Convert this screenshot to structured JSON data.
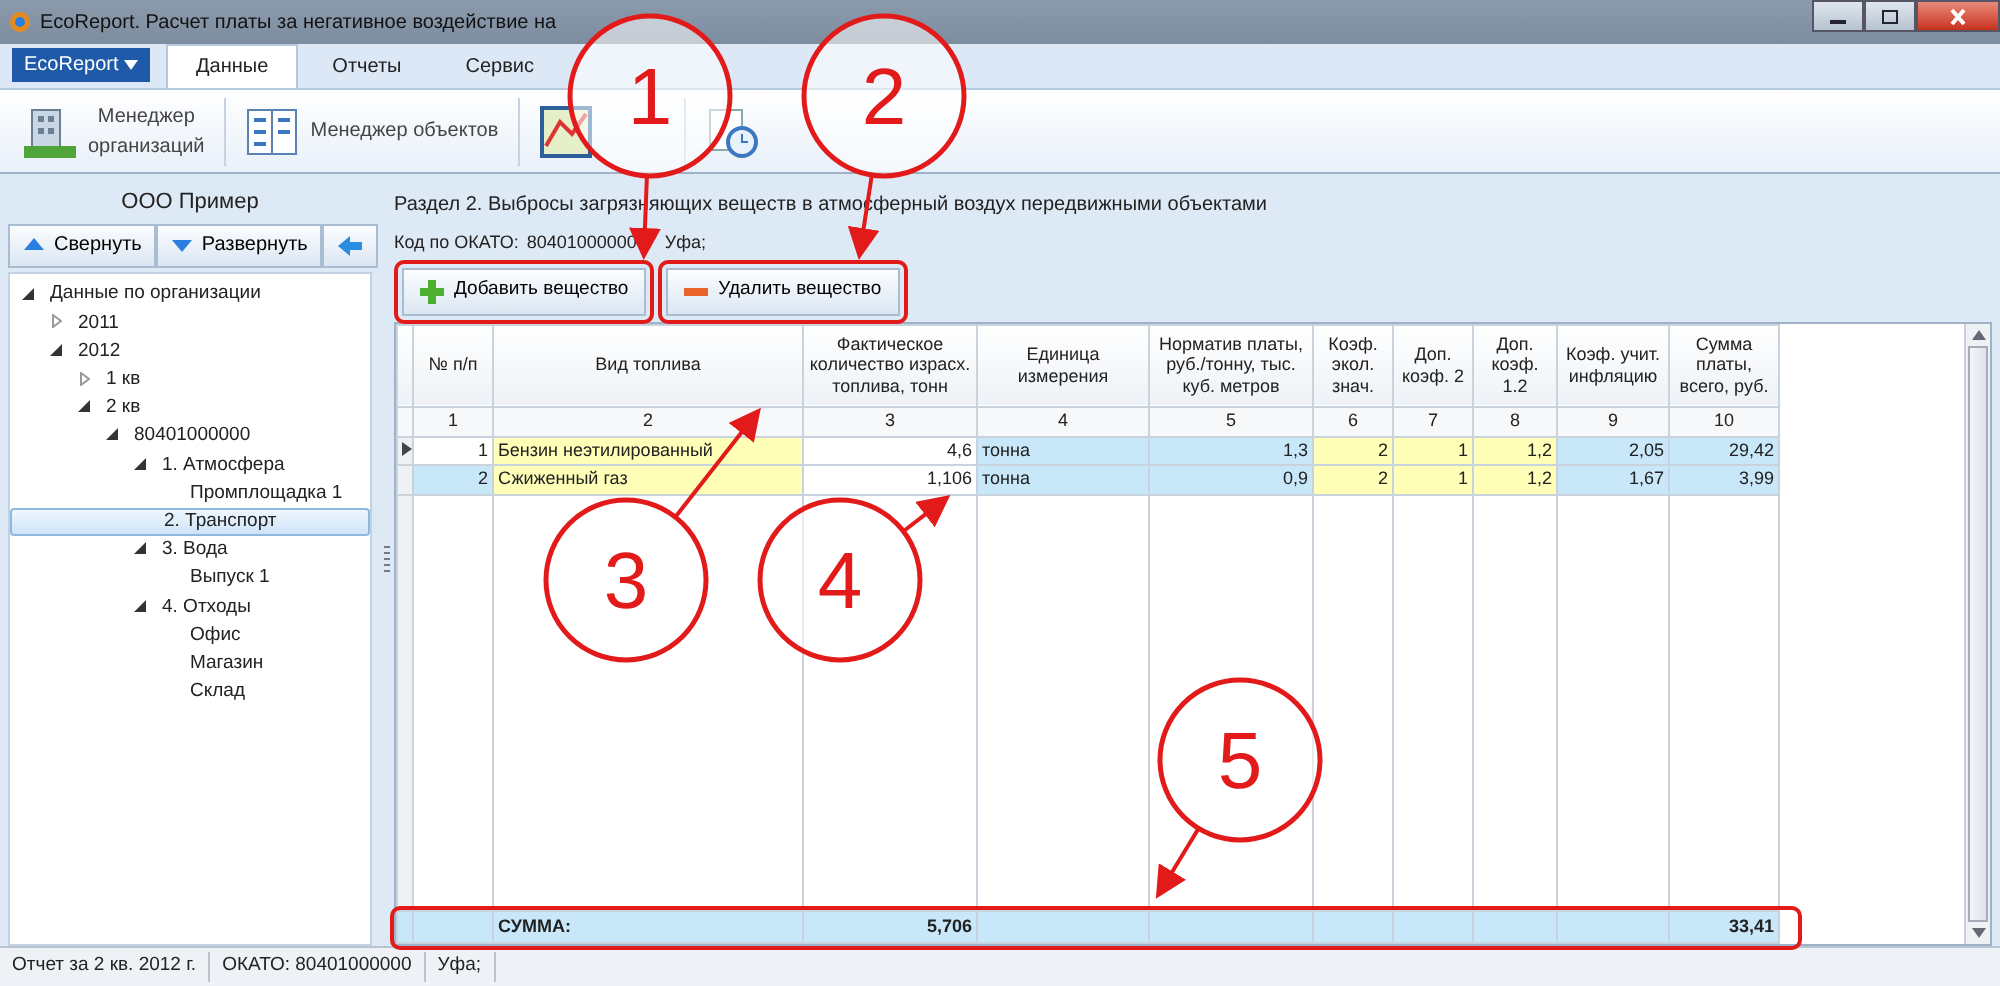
{
  "window": {
    "title": "EcoReport. Расчет платы за негативное воздействие на"
  },
  "app_menu": {
    "label": "EcoReport"
  },
  "tabs": [
    {
      "label": "Данные",
      "selected": true
    },
    {
      "label": "Отчеты",
      "selected": false
    },
    {
      "label": "Сервис",
      "selected": false
    }
  ],
  "ribbon": [
    {
      "kind": "org",
      "label": "Менеджер\nорганизаций"
    },
    {
      "kind": "objects",
      "label": "Менеджер объектов"
    },
    {
      "kind": "map"
    },
    {
      "kind": "calc"
    }
  ],
  "sidebar": {
    "title": "ООО Пример",
    "buttons": [
      {
        "kind": "up",
        "label": "Свернуть"
      },
      {
        "kind": "down",
        "label": "Развернуть"
      },
      {
        "kind": "back"
      }
    ],
    "tree": [
      {
        "label": "Данные по организации",
        "expanded": true,
        "selected": false,
        "children": [
          {
            "label": "2011",
            "expanded": false,
            "selected": false
          },
          {
            "label": "2012",
            "expanded": true,
            "selected": false,
            "children": [
              {
                "label": "1 кв",
                "expanded": false,
                "selected": false
              },
              {
                "label": "2 кв",
                "expanded": true,
                "selected": false,
                "children": [
                  {
                    "label": "80401000000",
                    "expanded": true,
                    "selected": false,
                    "children": [
                      {
                        "label": "1. Атмосфера",
                        "expanded": true,
                        "selected": false,
                        "children": [
                          {
                            "label": "Промплощадка 1",
                            "selected": false
                          }
                        ]
                      },
                      {
                        "label": "2. Транспорт",
                        "selected": true
                      },
                      {
                        "label": "3. Вода",
                        "expanded": true,
                        "selected": false,
                        "children": [
                          {
                            "label": "Выпуск 1",
                            "selected": false
                          }
                        ]
                      },
                      {
                        "label": "4. Отходы",
                        "expanded": true,
                        "selected": false,
                        "children": [
                          {
                            "label": "Офис",
                            "selected": false
                          },
                          {
                            "label": "Магазин",
                            "selected": false
                          },
                          {
                            "label": "Склад",
                            "selected": false
                          }
                        ]
                      }
                    ]
                  }
                ]
              }
            ]
          }
        ]
      }
    ]
  },
  "section": {
    "title": "Раздел 2. Выбросы загрязняющих веществ в атмосферный воздух передвижными объектами",
    "okato_label": "Код по ОКАТО:",
    "okato_value": "80401000000",
    "place": "Уфа;"
  },
  "toolbar": [
    {
      "kind": "add",
      "label": "Добавить вещество"
    },
    {
      "kind": "remove",
      "label": "Удалить вещество"
    }
  ],
  "table": {
    "columns": [
      {
        "header": "№ п/п",
        "number": "1",
        "kind": "plain"
      },
      {
        "header": "Вид топлива",
        "number": "2",
        "kind": "input"
      },
      {
        "header": "Фактическое количество израсх. топлива, тонн",
        "number": "3",
        "kind": "plain"
      },
      {
        "header": "Единица измерения",
        "number": "4",
        "kind": "calc"
      },
      {
        "header": "Норматив платы, руб./тонну, тыс. куб. метров",
        "number": "5",
        "kind": "calc"
      },
      {
        "header": "Коэф. экол. знач.",
        "number": "6",
        "kind": "input"
      },
      {
        "header": "Доп. коэф. 2",
        "number": "7",
        "kind": "input"
      },
      {
        "header": "Доп. коэф. 1.2",
        "number": "8",
        "kind": "input"
      },
      {
        "header": "Коэф. учит. инфляцию",
        "number": "9",
        "kind": "calc"
      },
      {
        "header": "Сумма платы, всего, руб.",
        "number": "10",
        "kind": "calc"
      }
    ],
    "rows": [
      {
        "current": true,
        "cells": [
          "1",
          "Бензин неэтилированный",
          "4,6",
          "тонна",
          "1,3",
          "2",
          "1",
          "1,2",
          "2,05",
          "29,42"
        ]
      },
      {
        "current": false,
        "cells": [
          "2",
          "Сжиженный газ",
          "1,106",
          "тонна",
          "0,9",
          "2",
          "1",
          "1,2",
          "1,67",
          "3,99"
        ]
      }
    ],
    "footer": {
      "label": "СУММА:",
      "fuel_total": "5,706",
      "payment_total": "33,41"
    }
  },
  "status_bar": [
    "Отчет за 2 кв. 2012 г.",
    "ОКАТО: 80401000000",
    "Уфа;"
  ],
  "callouts": [
    {
      "number": "1"
    },
    {
      "number": "2"
    },
    {
      "number": "3"
    },
    {
      "number": "4"
    },
    {
      "number": "5"
    }
  ]
}
